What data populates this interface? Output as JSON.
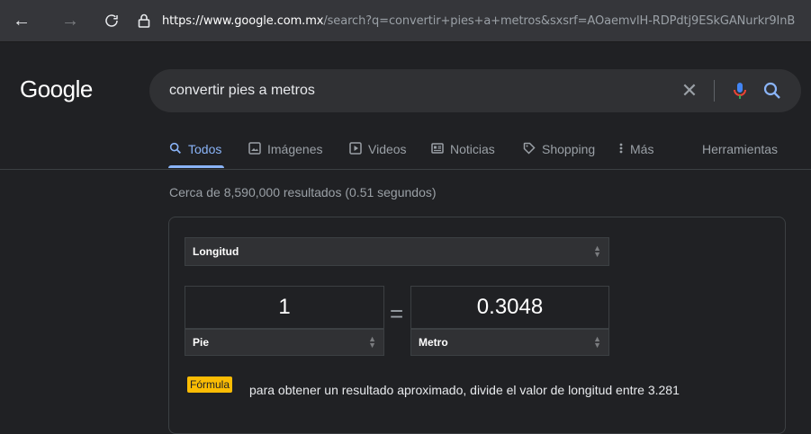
{
  "browser": {
    "url_prefix": "https://",
    "url_domain": "www.google.com.mx",
    "url_rest": "/search?q=convertir+pies+a+metros&sxsrf=AOaemvlH-RDPdtj9ESkGANurkr9InB"
  },
  "header": {
    "logo": "Google",
    "search_query": "convertir pies a metros"
  },
  "tabs": [
    {
      "label": "Todos",
      "icon": "search-icon"
    },
    {
      "label": "Imágenes",
      "icon": "image-icon"
    },
    {
      "label": "Videos",
      "icon": "play-icon"
    },
    {
      "label": "Noticias",
      "icon": "news-icon"
    },
    {
      "label": "Shopping",
      "icon": "tag-icon"
    },
    {
      "label": "Más",
      "icon": "more-vert-icon"
    },
    {
      "label": "Herramientas",
      "icon": ""
    }
  ],
  "result_stats": "Cerca de 8,590,000 resultados (0.51 segundos)",
  "converter": {
    "category": "Longitud",
    "from_value": "1",
    "from_unit": "Pie",
    "equals": "=",
    "to_value": "0.3048",
    "to_unit": "Metro",
    "formula_label": "Fórmula",
    "formula_text": "para obtener un resultado aproximado, divide el valor de longitud entre 3.281"
  },
  "colors": {
    "background": "#202124",
    "accent": "#8ab4f8",
    "formula_badge": "#fbbc04"
  }
}
